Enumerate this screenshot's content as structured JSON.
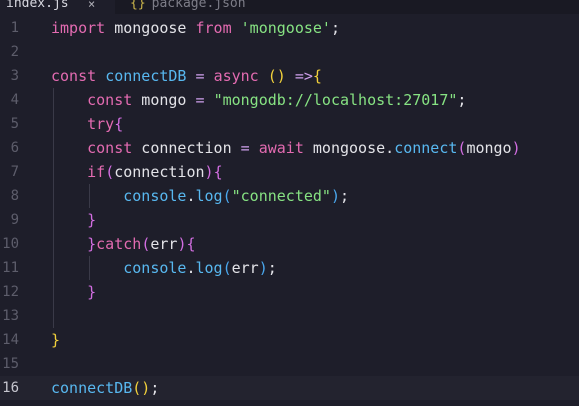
{
  "tabs": [
    {
      "label": "index.js",
      "close": "×"
    },
    {
      "label": "package.json",
      "icon": "json-braces-icon",
      "icon_glyph": "{}"
    }
  ],
  "colors": {
    "background": "#1e1e2a",
    "keyword": "#e36bb1",
    "function": "#58b8f0",
    "string": "#87e383",
    "bracket_level1": "#f2d13b",
    "bracket_level2": "#d36ee2",
    "bracket_level3": "#4aa8ef"
  },
  "editor": {
    "current_line": 16,
    "lines": [
      {
        "n": "1",
        "tokens": [
          [
            "kw",
            "import"
          ],
          [
            "plain",
            " mongoose "
          ],
          [
            "kw",
            "from"
          ],
          [
            "plain",
            " "
          ],
          [
            "str",
            "'mongoose'"
          ],
          [
            "plain",
            ";"
          ]
        ]
      },
      {
        "n": "2",
        "tokens": []
      },
      {
        "n": "3",
        "tokens": [
          [
            "kw",
            "const"
          ],
          [
            "plain",
            " "
          ],
          [
            "fn",
            "connectDB"
          ],
          [
            "plain",
            " "
          ],
          [
            "op",
            "="
          ],
          [
            "plain",
            " "
          ],
          [
            "kw",
            "async"
          ],
          [
            "plain",
            " "
          ],
          [
            "br1",
            "()"
          ],
          [
            "plain",
            " "
          ],
          [
            "op",
            "=>"
          ],
          [
            "br1",
            "{"
          ]
        ]
      },
      {
        "n": "4",
        "tokens": [
          [
            "plain",
            "    "
          ],
          [
            "kw",
            "const"
          ],
          [
            "plain",
            " mongo "
          ],
          [
            "op",
            "="
          ],
          [
            "plain",
            " "
          ],
          [
            "str",
            "\"mongodb://localhost:27017\""
          ],
          [
            "plain",
            ";"
          ]
        ]
      },
      {
        "n": "5",
        "tokens": [
          [
            "plain",
            "    "
          ],
          [
            "kw",
            "try"
          ],
          [
            "br2",
            "{"
          ]
        ]
      },
      {
        "n": "6",
        "tokens": [
          [
            "plain",
            "    "
          ],
          [
            "kw",
            "const"
          ],
          [
            "plain",
            " connection "
          ],
          [
            "op",
            "="
          ],
          [
            "plain",
            " "
          ],
          [
            "kw",
            "await"
          ],
          [
            "plain",
            " mongoose."
          ],
          [
            "fn",
            "connect"
          ],
          [
            "br2",
            "("
          ],
          [
            "plain",
            "mongo"
          ],
          [
            "br2",
            ")"
          ]
        ]
      },
      {
        "n": "7",
        "tokens": [
          [
            "plain",
            "    "
          ],
          [
            "kw",
            "if"
          ],
          [
            "br2",
            "("
          ],
          [
            "plain",
            "connection"
          ],
          [
            "br2",
            ")"
          ],
          [
            "br2",
            "{"
          ]
        ]
      },
      {
        "n": "8",
        "tokens": [
          [
            "plain",
            "        "
          ],
          [
            "fn",
            "console"
          ],
          [
            "plain",
            "."
          ],
          [
            "fn",
            "log"
          ],
          [
            "br3",
            "("
          ],
          [
            "str",
            "\"connected\""
          ],
          [
            "br3",
            ")"
          ],
          [
            "plain",
            ";"
          ]
        ]
      },
      {
        "n": "9",
        "tokens": [
          [
            "plain",
            "    "
          ],
          [
            "br2",
            "}"
          ]
        ]
      },
      {
        "n": "10",
        "tokens": [
          [
            "plain",
            "    "
          ],
          [
            "br2",
            "}"
          ],
          [
            "kw",
            "catch"
          ],
          [
            "br2",
            "("
          ],
          [
            "plain",
            "err"
          ],
          [
            "br2",
            ")"
          ],
          [
            "br2",
            "{"
          ]
        ]
      },
      {
        "n": "11",
        "tokens": [
          [
            "plain",
            "        "
          ],
          [
            "fn",
            "console"
          ],
          [
            "plain",
            "."
          ],
          [
            "fn",
            "log"
          ],
          [
            "br3",
            "("
          ],
          [
            "plain",
            "err"
          ],
          [
            "br3",
            ")"
          ],
          [
            "plain",
            ";"
          ]
        ]
      },
      {
        "n": "12",
        "tokens": [
          [
            "plain",
            "    "
          ],
          [
            "br2",
            "}"
          ]
        ]
      },
      {
        "n": "13",
        "tokens": []
      },
      {
        "n": "14",
        "tokens": [
          [
            "br1",
            "}"
          ]
        ]
      },
      {
        "n": "15",
        "tokens": []
      },
      {
        "n": "16",
        "tokens": [
          [
            "fn",
            "connectDB"
          ],
          [
            "br1",
            "()"
          ],
          [
            "plain",
            ";"
          ]
        ]
      }
    ]
  }
}
